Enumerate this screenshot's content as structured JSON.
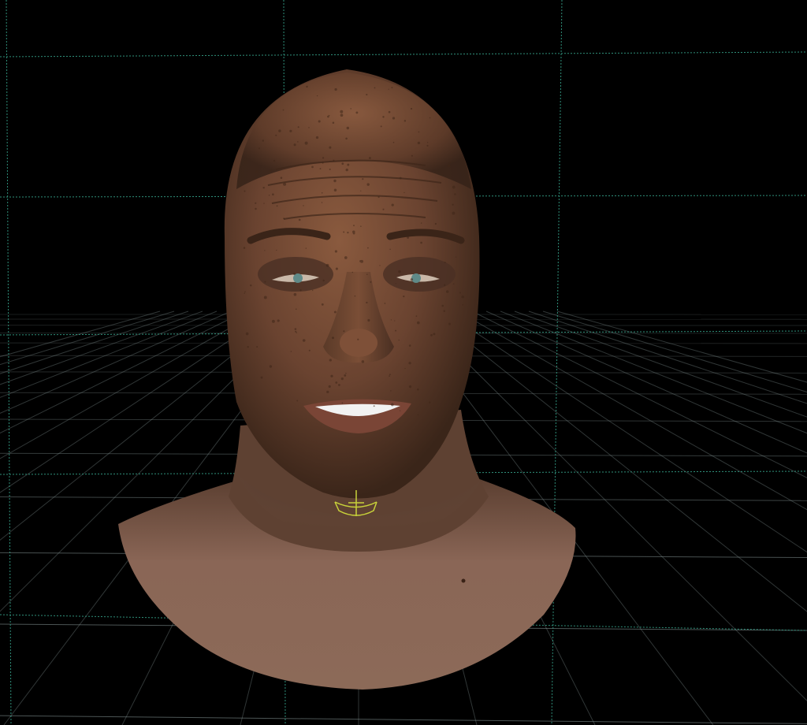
{
  "viewport": {
    "background_color": "#000000",
    "guide_grid_color": "#2f8f7a",
    "floor_grid_color": "#8a9a9a",
    "locator_color": "#c8d23a",
    "subject": "3d-head-bust-model"
  }
}
